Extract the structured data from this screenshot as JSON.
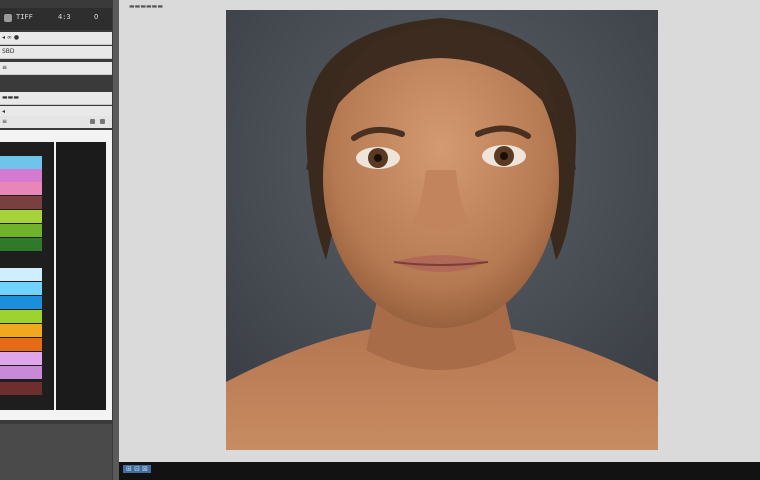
{
  "sidebar": {
    "header_labels": [
      "TIFF",
      "4:3",
      "O"
    ],
    "rows": [
      {
        "label": "◂ ∞ ●"
      },
      {
        "label": "SBD"
      },
      {
        "label": "≡"
      },
      {
        "label": "▬▬▬"
      },
      {
        "label": "◂"
      }
    ],
    "palette_title": "≡",
    "swatches": [
      "#6fc4ec",
      "#d47ad0",
      "#e886b8",
      "#7a4040",
      "#a6d23a",
      "#6fb32a",
      "#2f7a2a",
      "#cfeeff",
      "#6fd2ff",
      "#1c8fdc",
      "#9ed22e",
      "#f2a81e",
      "#e66b16",
      "#e0a6ec",
      "#c88ad6",
      "#6e2e2e"
    ]
  },
  "canvas": {
    "title": "▬▬▬▬▬▬"
  },
  "status": {
    "text": "⊞ ⊟ ⊠"
  }
}
